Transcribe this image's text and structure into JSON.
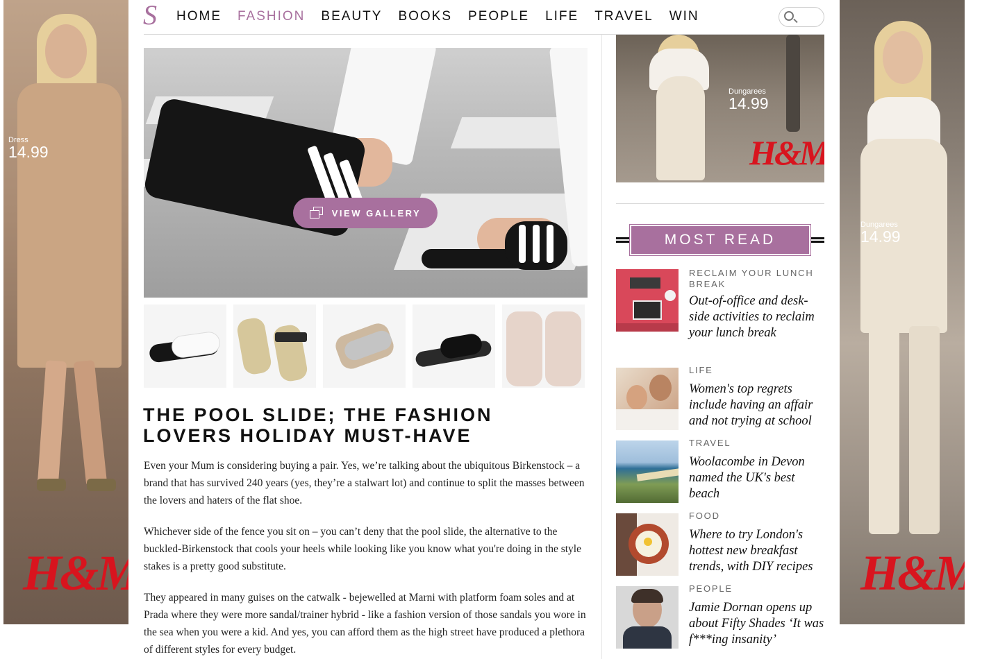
{
  "header": {
    "logo": "S",
    "nav": [
      "HOME",
      "FASHION",
      "BEAUTY",
      "BOOKS",
      "PEOPLE",
      "LIFE",
      "TRAVEL",
      "WIN"
    ],
    "active": "FASHION"
  },
  "ads": {
    "left": {
      "label": "Dress",
      "price": "14.99",
      "brand": "H&M"
    },
    "right_box": {
      "label": "Dungarees",
      "price": "14.99",
      "brand": "H&M"
    },
    "right": {
      "label": "Dungarees",
      "price": "14.99",
      "brand": "H&M"
    }
  },
  "hero": {
    "gallery_label": "VIEW GALLERY"
  },
  "article": {
    "headline": "THE POOL SLIDE; THE FASHION LOVERS HOLIDAY MUST-HAVE",
    "paragraphs": [
      "Even your Mum is considering buying a pair. Yes, we’re talking about the ubiquitous Birkenstock – a brand that has survived 240 years (yes, they’re a stalwart lot) and continue to split the masses between the lovers and haters of the flat shoe.",
      "Whichever side of the fence you sit on – you can’t deny that the pool slide, the alternative to the buckled-Birkenstock that cools your heels while looking like you know what you're doing in the style stakes is a pretty good substitute.",
      "They appeared in many guises on the catwalk - bejewelled at Marni with platform foam soles and at Prada where they were more sandal/trainer hybrid - like a fashion version of those sandals you wore in the sea when you were a kid. And yes, you can afford them as the high street have produced a plethora of different styles for every budget."
    ]
  },
  "most_read": {
    "heading": "MOST READ",
    "items": [
      {
        "category": "RECLAIM YOUR LUNCH BREAK",
        "title": "Out-of-office and desk-side activities to reclaim your lunch break"
      },
      {
        "category": "LIFE",
        "title": "Women's top regrets include having an affair and not trying at school"
      },
      {
        "category": "TRAVEL",
        "title": "Woolacombe in Devon named the UK's best beach"
      },
      {
        "category": "FOOD",
        "title": "Where to try London's hottest new breakfast trends, with DIY recipes"
      },
      {
        "category": "PEOPLE",
        "title": "Jamie Dornan opens up about Fifty Shades ‘It was f***ing insanity’"
      }
    ]
  },
  "colors": {
    "accent": "#a8709e",
    "hm_red": "#d8141e"
  }
}
